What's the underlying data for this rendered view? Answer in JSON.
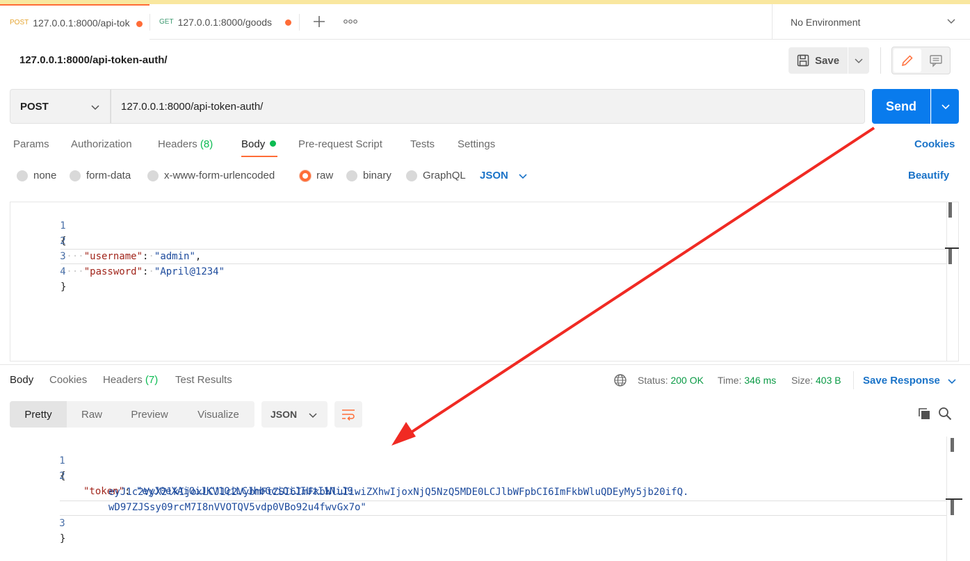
{
  "tabs": [
    {
      "method": "POST",
      "label": "127.0.0.1:8000/api-tok",
      "unsaved": true,
      "active": true
    },
    {
      "method": "GET",
      "label": "127.0.0.1:8000/goods",
      "unsaved": true,
      "active": false
    }
  ],
  "environment": {
    "label": "No Environment"
  },
  "request": {
    "title": "127.0.0.1:8000/api-token-auth/",
    "save_label": "Save",
    "method": "POST",
    "url": "127.0.0.1:8000/api-token-auth/",
    "send_label": "Send",
    "tabs": {
      "params": "Params",
      "authorization": "Authorization",
      "headers": "Headers",
      "headers_count": "(8)",
      "body": "Body",
      "pre_request": "Pre-request Script",
      "tests": "Tests",
      "settings": "Settings"
    },
    "cookies_link": "Cookies",
    "body_types": {
      "none": "none",
      "form_data": "form-data",
      "urlencoded": "x-www-form-urlencoded",
      "raw": "raw",
      "binary": "binary",
      "graphql": "GraphQL"
    },
    "selected_body_type": "raw",
    "raw_format": "JSON",
    "beautify_label": "Beautify",
    "body_lines": {
      "n1": "1",
      "n2": "2",
      "n3": "3",
      "n4": "4",
      "open": "{",
      "k1": "\"username\"",
      "v1": "\"admin\"",
      "k2": "\"password\"",
      "v2": "\"April@1234\"",
      "close": "}"
    }
  },
  "response": {
    "tabs": {
      "body": "Body",
      "cookies": "Cookies",
      "headers": "Headers",
      "headers_count": "(7)",
      "test_results": "Test Results"
    },
    "status_label": "Status:",
    "status_value": "200 OK",
    "time_label": "Time:",
    "time_value": "346 ms",
    "size_label": "Size:",
    "size_value": "403 B",
    "save_response_label": "Save Response",
    "view_modes": {
      "pretty": "Pretty",
      "raw": "Raw",
      "preview": "Preview",
      "visualize": "Visualize"
    },
    "selected_view": "Pretty",
    "format": "JSON",
    "body_lines": {
      "n1": "1",
      "n2": "2",
      "n3": "3",
      "open": "{",
      "key": "\"token\"",
      "value_part1": "\"eyJ0eXAiOiJKV1QiLCJhbGciOiJIUzI1NiJ9.",
      "value_part2": "eyJ1c2VyX2lkIjoxLCJ1c2VybmFtZSI6ImFkbWluIiwiZXhwIjoxNjQ5NzQ5MDE0LCJlbWFpbCI6ImFkbWluQDEyMy5jb20ifQ.",
      "value_part3": "wD97ZJSsy09rcM7I8nVVOTQV5vdp0VBo92u4fwvGx7o\"",
      "close": "}"
    }
  },
  "colors": {
    "accent": "#ff6c37",
    "send": "#097bed",
    "link": "#1a73c8",
    "success": "#0cbb52",
    "annotation_arrow": "#f02a23"
  }
}
